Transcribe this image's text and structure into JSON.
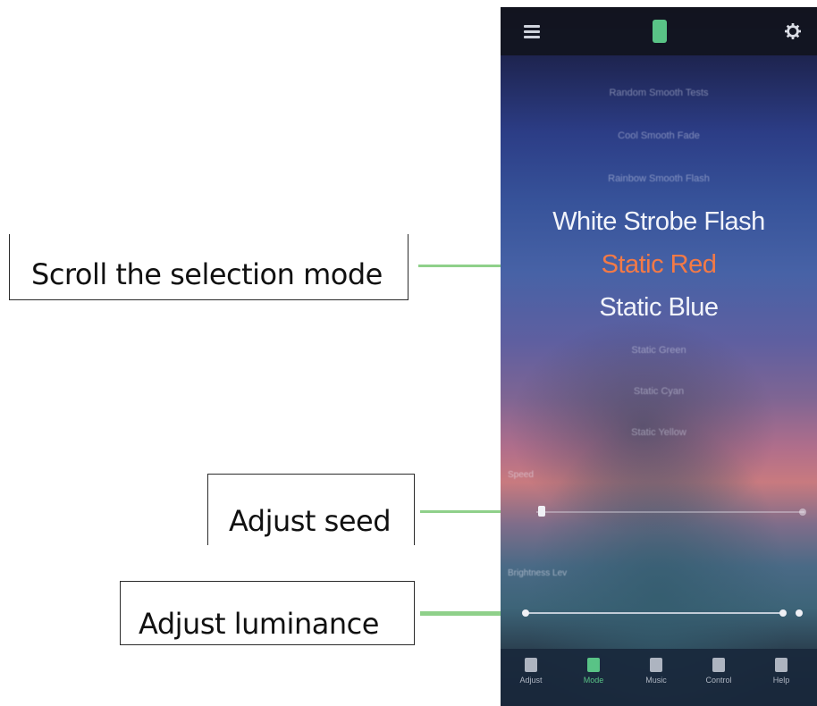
{
  "annotations": {
    "scroll": "Scroll the selection mode",
    "seed": "Adjust seed",
    "luminance": "Adjust luminance",
    "arrow_color": "#8fd08a"
  },
  "app": {
    "top_bar": {
      "menu_icon": "menu-icon",
      "center_icon": "phone-icon",
      "settings_icon": "gear-icon"
    },
    "mode_wheel": {
      "items": [
        "Random Smooth Tests",
        "Cool Smooth Fade",
        "Rainbow Smooth Flash",
        "White Strobe Flash",
        "Static Red",
        "Static Blue",
        "Static Green",
        "Static Cyan",
        "Static Yellow"
      ],
      "selected_index": 4,
      "selected_color": "#f47a46"
    },
    "sliders": [
      {
        "label": "Speed",
        "value": 0.05
      },
      {
        "label": "Brightness Lev",
        "value": 1.0
      }
    ],
    "tab_bar": {
      "tabs": [
        {
          "label": "Adjust",
          "icon": "sliders-icon",
          "active": false
        },
        {
          "label": "Mode",
          "icon": "mode-icon",
          "active": true
        },
        {
          "label": "Music",
          "icon": "microphone-icon",
          "active": false
        },
        {
          "label": "Control",
          "icon": "timer-icon",
          "active": false
        },
        {
          "label": "Help",
          "icon": "help-icon",
          "active": false
        }
      ],
      "active_color": "#59c386"
    }
  }
}
